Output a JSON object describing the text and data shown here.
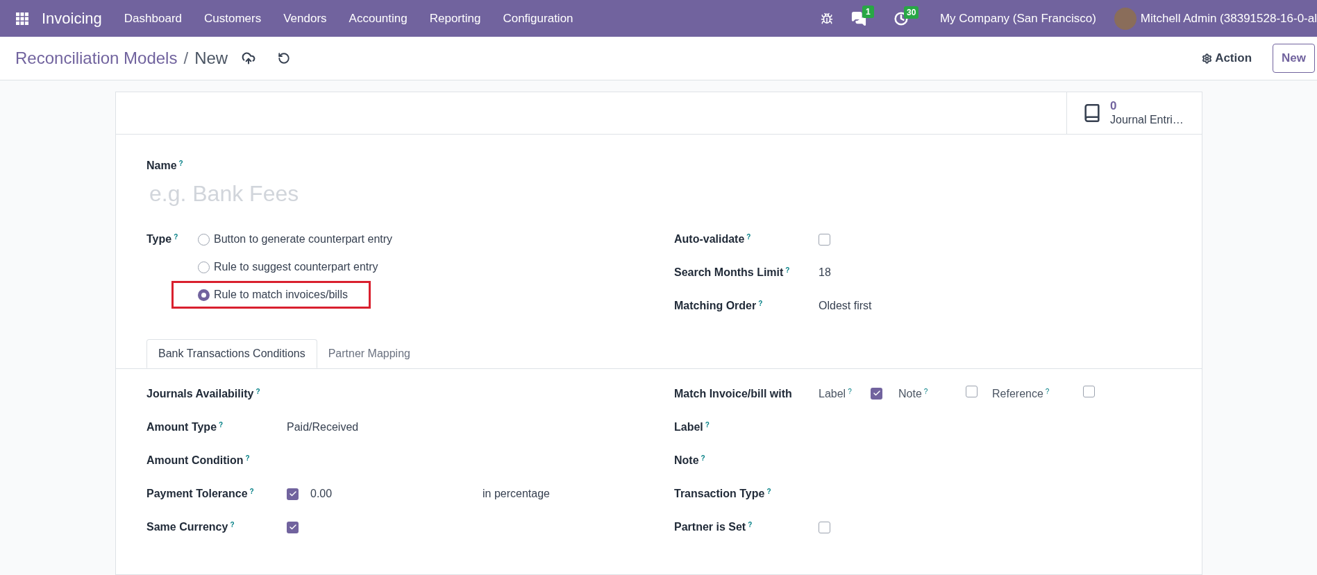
{
  "navbar": {
    "app": "Invoicing",
    "menu": [
      "Dashboard",
      "Customers",
      "Vendors",
      "Accounting",
      "Reporting",
      "Configuration"
    ],
    "messages_count": "1",
    "activities_count": "30",
    "company": "My Company (San Francisco)",
    "user": "Mitchell Admin (38391528-16-0-al"
  },
  "breadcrumb": {
    "parent": "Reconciliation Models",
    "separator": "/",
    "current": "New"
  },
  "actions": {
    "action": "Action",
    "new": "New"
  },
  "smart_button": {
    "count": "0",
    "label": "Journal Entri…"
  },
  "name": {
    "label": "Name$^{?}$",
    "placeholder": "e.g. Bank Fees"
  },
  "type": {
    "label": "Type$^{?}$",
    "options": [
      {
        "label": "Button to generate counterpart entry",
        "selected": false,
        "highlighted": false
      },
      {
        "label": "Rule to suggest counterpart entry",
        "selected": false,
        "highlighted": false
      },
      {
        "label": "Rule to match invoices/bills",
        "selected": true,
        "highlighted": true
      }
    ]
  },
  "top_right_fields": [
    {
      "label": "Auto-validate$^{?}$",
      "kind": "checkbox",
      "checked": false
    },
    {
      "label": "Search Months Limit$^{?}$",
      "kind": "text",
      "value": "18"
    },
    {
      "label": "Matching Order$^{?}$",
      "kind": "text",
      "value": "Oldest first"
    }
  ],
  "tabs": [
    {
      "label": "Bank Transactions Conditions",
      "selected": true
    },
    {
      "label": "Partner Mapping",
      "selected": false
    }
  ],
  "left_fields": [
    {
      "label": "Journals Availability$^{?}$",
      "kind": "empty"
    },
    {
      "label": "Amount Type$^{?}$",
      "kind": "text",
      "value": "Paid/Received"
    },
    {
      "label": "Amount Condition$^{?}$",
      "kind": "empty"
    },
    {
      "label": "Payment Tolerance$^{?}$",
      "kind": "tolerance",
      "checked": true,
      "value": "0.00",
      "suffix": "in percentage"
    },
    {
      "label": "Same Currency$^{?}$",
      "kind": "checkbox",
      "checked": true
    }
  ],
  "right_fields": [
    {
      "label": "Match Invoice/bill with",
      "kind": "match",
      "options": [
        {
          "label": "Label$^{?}$",
          "checked": true
        },
        {
          "label": "Note$^{?}$",
          "checked": false
        },
        {
          "label": "Reference$^{?}$",
          "checked": false
        }
      ]
    },
    {
      "label": "Label$^{?}$",
      "kind": "empty"
    },
    {
      "label": "Note$^{?}$",
      "kind": "empty"
    },
    {
      "label": "Transaction Type$^{?}$",
      "kind": "empty"
    },
    {
      "label": "Partner is Set$^{?}$",
      "kind": "checkbox",
      "checked": false
    }
  ]
}
